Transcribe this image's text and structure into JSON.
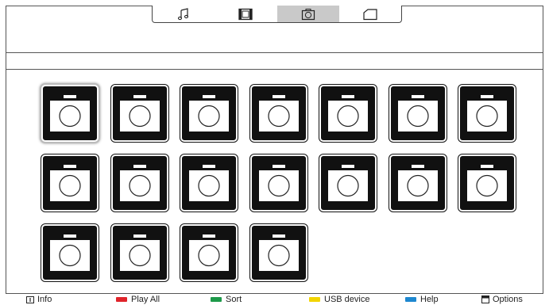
{
  "tabs": [
    {
      "icon": "music-note-icon",
      "active": false
    },
    {
      "icon": "film-icon",
      "active": false
    },
    {
      "icon": "camera-icon",
      "active": true
    },
    {
      "icon": "folder-icon",
      "active": false
    }
  ],
  "grid": {
    "items": [
      {
        "icon": "photo-folder-icon",
        "selected": true
      },
      {
        "icon": "photo-folder-icon",
        "selected": false
      },
      {
        "icon": "photo-folder-icon",
        "selected": false
      },
      {
        "icon": "photo-folder-icon",
        "selected": false
      },
      {
        "icon": "photo-folder-icon",
        "selected": false
      },
      {
        "icon": "photo-folder-icon",
        "selected": false
      },
      {
        "icon": "photo-folder-icon",
        "selected": false
      },
      {
        "icon": "photo-folder-icon",
        "selected": false
      },
      {
        "icon": "photo-folder-icon",
        "selected": false
      },
      {
        "icon": "photo-folder-icon",
        "selected": false
      },
      {
        "icon": "photo-folder-icon",
        "selected": false
      },
      {
        "icon": "photo-folder-icon",
        "selected": false
      },
      {
        "icon": "photo-folder-icon",
        "selected": false
      },
      {
        "icon": "photo-folder-icon",
        "selected": false
      },
      {
        "icon": "photo-folder-icon",
        "selected": false
      },
      {
        "icon": "photo-folder-icon",
        "selected": false
      },
      {
        "icon": "photo-folder-icon",
        "selected": false
      },
      {
        "icon": "photo-folder-icon",
        "selected": false
      }
    ]
  },
  "footer": {
    "info": {
      "label": "Info",
      "icon": "info-icon"
    },
    "play_all": {
      "label": "Play All",
      "color": "#e0242b"
    },
    "sort": {
      "label": "Sort",
      "color": "#1e9a4a"
    },
    "usb": {
      "label": "USB device",
      "color": "#f2d400"
    },
    "help": {
      "label": "Help",
      "color": "#1e88d0"
    },
    "options": {
      "label": "Options",
      "icon": "options-icon"
    }
  }
}
